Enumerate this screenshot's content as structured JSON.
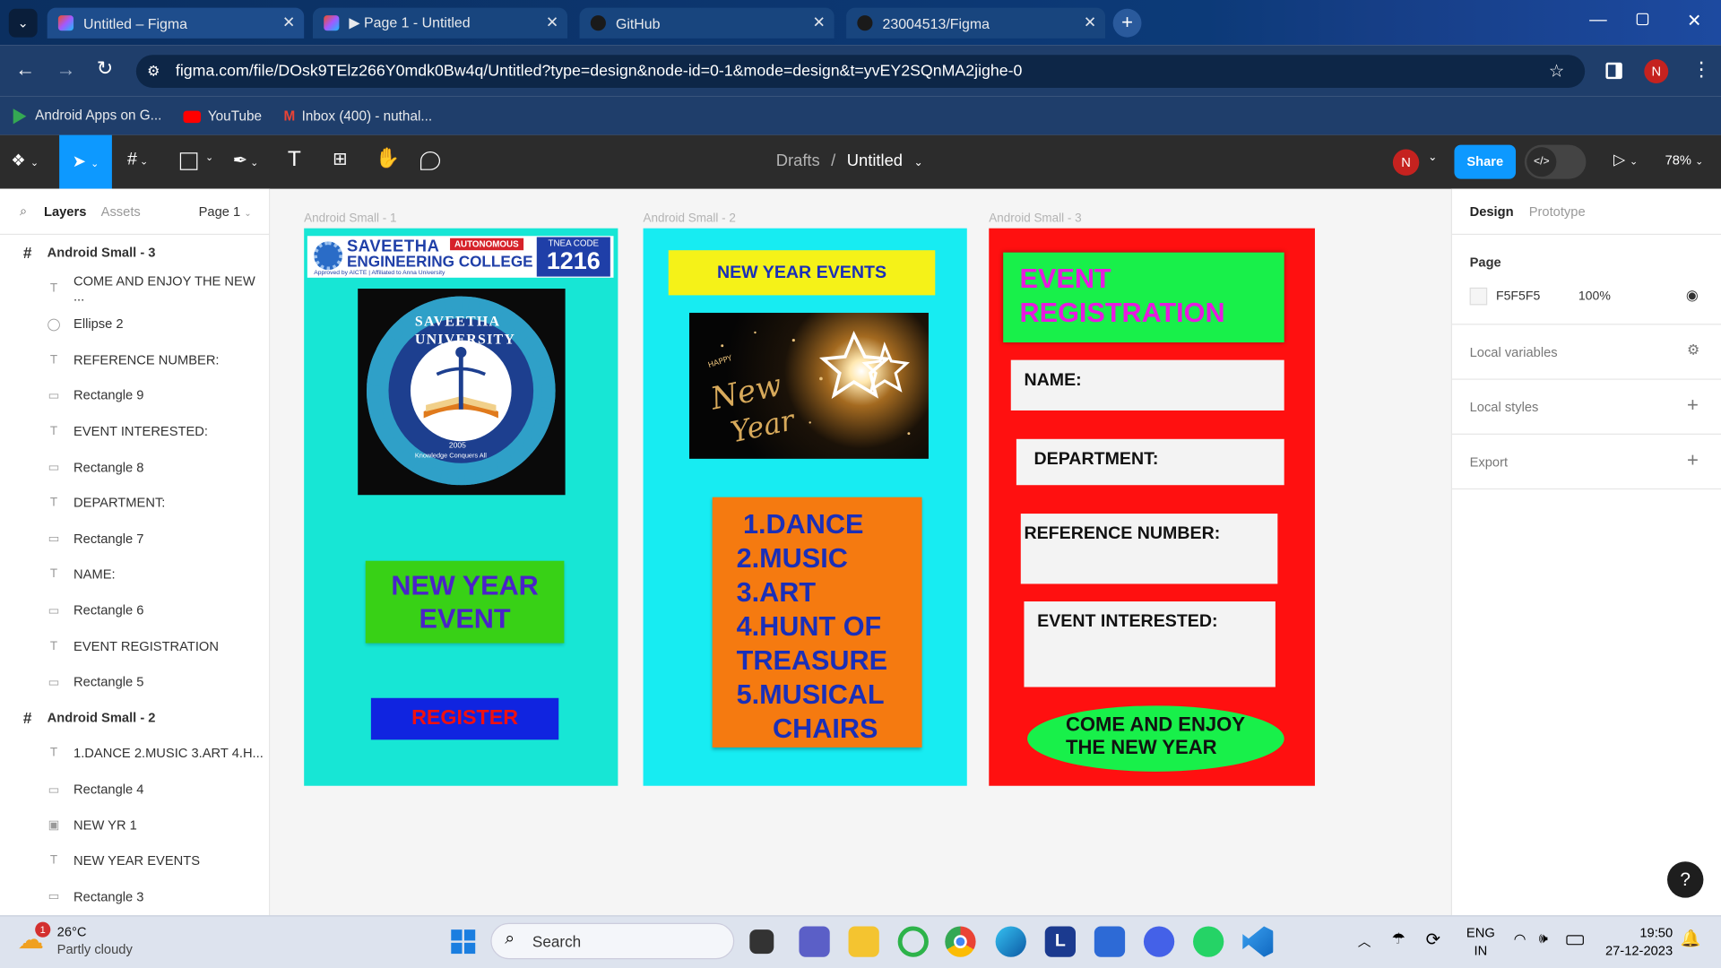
{
  "browser": {
    "tabs": [
      {
        "title": "Untitled – Figma"
      },
      {
        "title": "▶ Page 1 - Untitled"
      },
      {
        "title": "GitHub"
      },
      {
        "title": "23004513/Figma"
      }
    ],
    "url": "figma.com/file/DOsk9TElz266Y0mdk0Bw4q/Untitled?type=design&node-id=0-1&mode=design&t=yvEY2SQnMA2jighe-0",
    "avatar": "N",
    "bookmarks": [
      "Android Apps on G...",
      "YouTube",
      "Inbox (400) - nuthal..."
    ]
  },
  "figma": {
    "breadcrumb": {
      "folder": "Drafts",
      "sep": "/",
      "file": "Untitled"
    },
    "user": "N",
    "share": "Share",
    "zoom": "78%",
    "left": {
      "tabs": [
        "Layers",
        "Assets"
      ],
      "page": "Page 1",
      "layers": [
        {
          "name": "Android Small - 3",
          "kind": "frame"
        },
        {
          "name": "COME AND ENJOY THE NEW ...",
          "kind": "text"
        },
        {
          "name": "Ellipse 2",
          "kind": "ellipse"
        },
        {
          "name": "REFERENCE NUMBER:",
          "kind": "text"
        },
        {
          "name": "Rectangle 9",
          "kind": "rect"
        },
        {
          "name": "EVENT INTERESTED:",
          "kind": "text"
        },
        {
          "name": "Rectangle 8",
          "kind": "rect"
        },
        {
          "name": "DEPARTMENT:",
          "kind": "text"
        },
        {
          "name": "Rectangle 7",
          "kind": "rect"
        },
        {
          "name": "NAME:",
          "kind": "text"
        },
        {
          "name": "Rectangle 6",
          "kind": "rect"
        },
        {
          "name": "EVENT REGISTRATION",
          "kind": "text"
        },
        {
          "name": "Rectangle 5",
          "kind": "rect"
        },
        {
          "name": "Android Small - 2",
          "kind": "frame"
        },
        {
          "name": "1.DANCE 2.MUSIC 3.ART 4.H...",
          "kind": "text"
        },
        {
          "name": "Rectangle 4",
          "kind": "rect"
        },
        {
          "name": "NEW YR 1",
          "kind": "image"
        },
        {
          "name": "NEW YEAR EVENTS",
          "kind": "text"
        },
        {
          "name": "Rectangle 3",
          "kind": "rect"
        }
      ]
    },
    "right": {
      "tabs": [
        "Design",
        "Prototype"
      ],
      "page_label": "Page",
      "page_color": "F5F5F5",
      "page_opacity": "100%",
      "local_variables": "Local variables",
      "local_styles": "Local styles",
      "export": "Export"
    },
    "canvas": {
      "frame1": {
        "label": "Android Small - 1",
        "college_line1": "SAVEETHA",
        "college_line2": "ENGINEERING COLLEGE",
        "autonomous": "AUTONOMOUS",
        "tnea": "TNEA CODE",
        "code": "1216",
        "approved": "Approved by AICTE | Affiliated to Anna University",
        "seal_text": "SAVEETHA UNIVERSITY",
        "seal_year": "2005",
        "seal_motto": "Knowledge Conquers All",
        "event": "NEW YEAR EVENT",
        "register": "REGISTER"
      },
      "frame2": {
        "label": "Android Small - 2",
        "title": "NEW YEAR EVENTS",
        "list": [
          "1.DANCE",
          "2.MUSIC",
          "3.ART",
          "4.HUNT OF",
          "TREASURE",
          "5.MUSICAL",
          "CHAIRS"
        ]
      },
      "frame3": {
        "label": "Android Small - 3",
        "title": "EVENT REGISTRATION",
        "name": "NAME:",
        "dept": "DEPARTMENT:",
        "ref": "REFERENCE NUMBER:",
        "interest": "EVENT INTERESTED:",
        "enjoy": "COME AND ENJOY THE NEW YEAR"
      }
    },
    "colors": {
      "frame1": "#17e6d5",
      "frame2": "#17ecf2",
      "frame3": "#ff1010",
      "accent": "#0d99ff"
    }
  },
  "taskbar": {
    "temp": "26°C",
    "weather": "Partly cloudy",
    "search": "Search",
    "lang1": "ENG",
    "lang2": "IN",
    "time": "19:50",
    "date": "27-12-2023"
  }
}
